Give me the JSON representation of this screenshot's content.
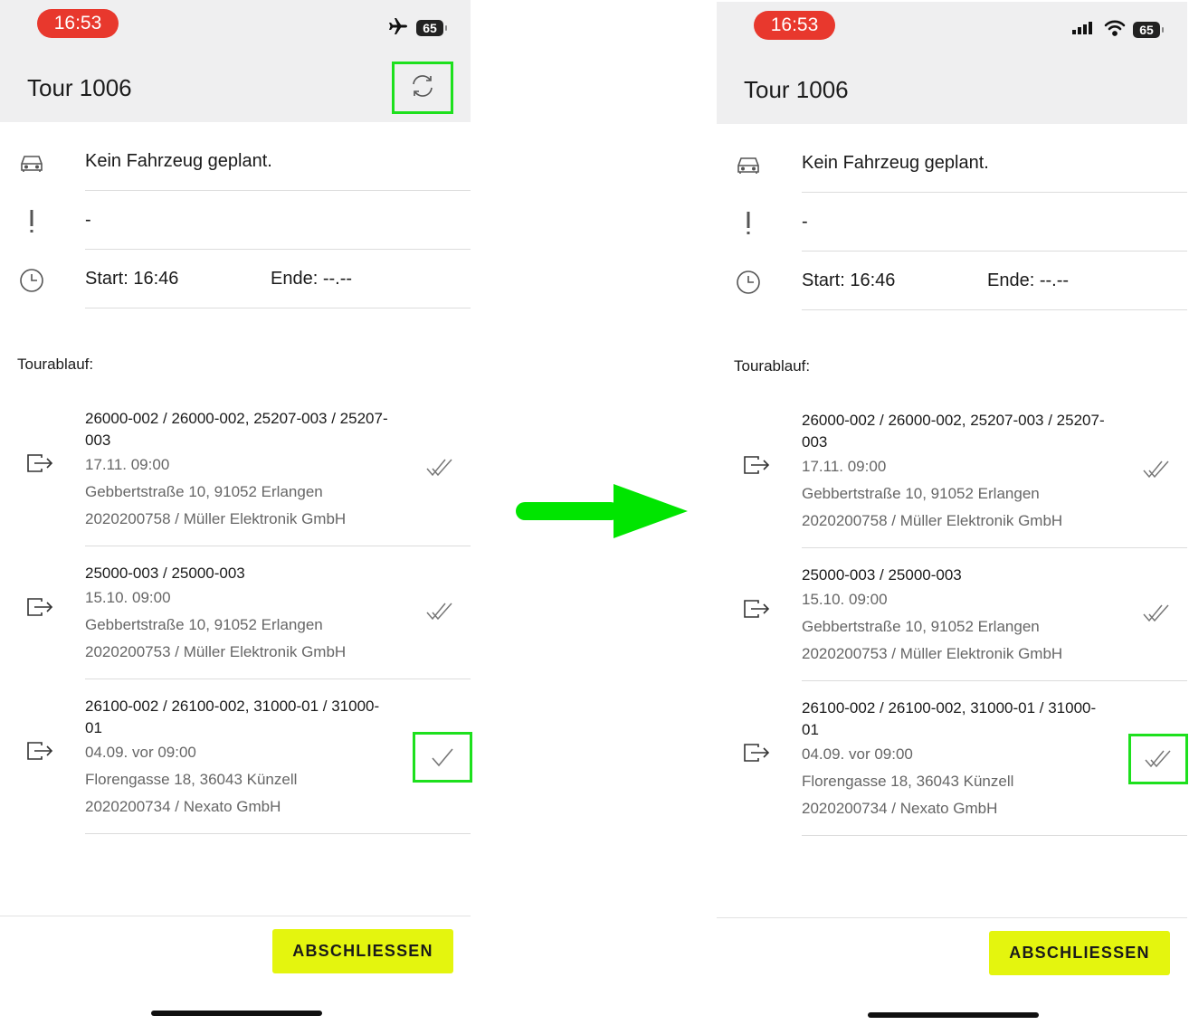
{
  "colors": {
    "highlight": "#1de01d",
    "accent_button": "#e4f50e",
    "status_time": "#e8382d",
    "arrow": "#00e500",
    "header_bg": "#efeff0"
  },
  "screens": {
    "left": {
      "status": {
        "time": "16:53",
        "battery": "65",
        "icons": [
          "airplane-icon",
          "battery-icon"
        ]
      },
      "header": {
        "title": "Tour 1006",
        "refresh_icon": "refresh-icon"
      },
      "info": {
        "vehicle": "Kein Fahrzeug geplant.",
        "priority": "-",
        "start": "Start: 16:46",
        "end": "Ende: --.--"
      },
      "section_label": "Tourablauf:",
      "stops": [
        {
          "ids": "26000-002 / 26000-002, 25207-003 / 25207-003",
          "date": "17.11. 09:00",
          "address": "Gebbertstraße 10, 91052 Erlangen",
          "customer": "2020200758 / Müller Elektronik GmbH",
          "status_icon": "double-check-icon"
        },
        {
          "ids": "25000-003 / 25000-003",
          "date": "15.10. 09:00",
          "address": "Gebbertstraße 10, 91052 Erlangen",
          "customer": "2020200753 / Müller Elektronik GmbH",
          "status_icon": "double-check-icon"
        },
        {
          "ids": "26100-002 / 26100-002, 31000-01 / 31000-01",
          "date": "04.09. vor 09:00",
          "address": "Florengasse 18, 36043 Künzell",
          "customer": "2020200734 / Nexato GmbH",
          "status_icon": "check-icon"
        }
      ],
      "button": "ABSCHLIESSEN"
    },
    "right": {
      "status": {
        "time": "16:53",
        "battery": "65",
        "icons": [
          "signal-icon",
          "wifi-icon",
          "battery-icon"
        ]
      },
      "header": {
        "title": "Tour 1006"
      },
      "info": {
        "vehicle": "Kein Fahrzeug geplant.",
        "priority": "-",
        "start": "Start: 16:46",
        "end": "Ende: --.--"
      },
      "section_label": "Tourablauf:",
      "stops": [
        {
          "ids": "26000-002 / 26000-002, 25207-003 / 25207-003",
          "date": "17.11. 09:00",
          "address": "Gebbertstraße 10, 91052 Erlangen",
          "customer": "2020200758 / Müller Elektronik GmbH",
          "status_icon": "double-check-icon"
        },
        {
          "ids": "25000-003 / 25000-003",
          "date": "15.10. 09:00",
          "address": "Gebbertstraße 10, 91052 Erlangen",
          "customer": "2020200753 / Müller Elektronik GmbH",
          "status_icon": "double-check-icon"
        },
        {
          "ids": "26100-002 / 26100-002, 31000-01 / 31000-01",
          "date": "04.09. vor 09:00",
          "address": "Florengasse 18, 36043 Künzell",
          "customer": "2020200734 / Nexato GmbH",
          "status_icon": "double-check-icon"
        }
      ],
      "button": "ABSCHLIESSEN"
    }
  }
}
